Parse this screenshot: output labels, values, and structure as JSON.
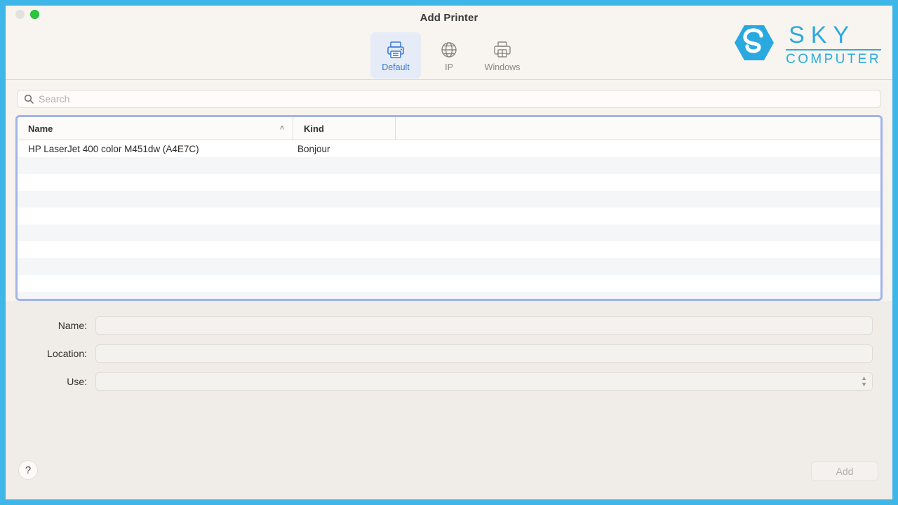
{
  "window": {
    "title": "Add Printer",
    "traffic_lights": [
      "close",
      "minimize",
      "zoom"
    ]
  },
  "toolbar": {
    "tabs": [
      {
        "label": "Default",
        "icon": "printer-icon",
        "selected": true
      },
      {
        "label": "IP",
        "icon": "globe-icon",
        "selected": false
      },
      {
        "label": "Windows",
        "icon": "windows-printer-icon",
        "selected": false
      }
    ]
  },
  "branding": {
    "logo_mark": "sky-hexagon-s-icon",
    "line1": "SKY",
    "line2": "COMPUTER",
    "color": "#29abe2"
  },
  "search": {
    "placeholder": "Search",
    "value": "",
    "icon": "search-icon"
  },
  "printer_list": {
    "columns": [
      "Name",
      "Kind"
    ],
    "sort_column": "Name",
    "sort_direction": "ascending",
    "sort_glyph": "˄",
    "rows": [
      {
        "name": "HP LaserJet 400 color M451dw (A4E7C)",
        "kind": "Bonjour"
      }
    ],
    "empty_row_count": 10
  },
  "form": {
    "fields": [
      {
        "label": "Name:",
        "value": "",
        "type": "text"
      },
      {
        "label": "Location:",
        "value": "",
        "type": "text"
      },
      {
        "label": "Use:",
        "value": "",
        "type": "select"
      }
    ]
  },
  "footer": {
    "help_label": "?",
    "add_label": "Add",
    "add_enabled": false
  },
  "frame": {
    "border_color": "#3fb6e8"
  }
}
